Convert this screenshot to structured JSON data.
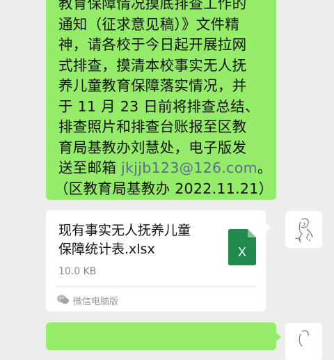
{
  "message1": {
    "lines": [
      "教育保障情况摸底排查工作的",
      "通知（征求意见稿）》文件精",
      "神，请各校于今日起开展拉网",
      "式排查，摸清本校事实无人抚",
      "养儿童教育保障落实情况，并",
      "于 11 月 23 日前将排查总结、",
      "排查照片和排查台账报至区教",
      "育局基教办刘慧处，电子版发",
      "送至邮箱 ",
      "jkjjb123@126.com",
      "。",
      "（区教育局基教办 2022.11.21）"
    ]
  },
  "file_message": {
    "name_lines": [
      "现有事实无人抚养儿童",
      "保障统计表.xlsx"
    ],
    "size": "10.0 KB",
    "icon_letter": "X",
    "source": "微信电脑版"
  },
  "colors": {
    "bubble": "#95ec69",
    "link": "#576b95",
    "excel": "#1f8a4c",
    "background": "#ededed"
  }
}
